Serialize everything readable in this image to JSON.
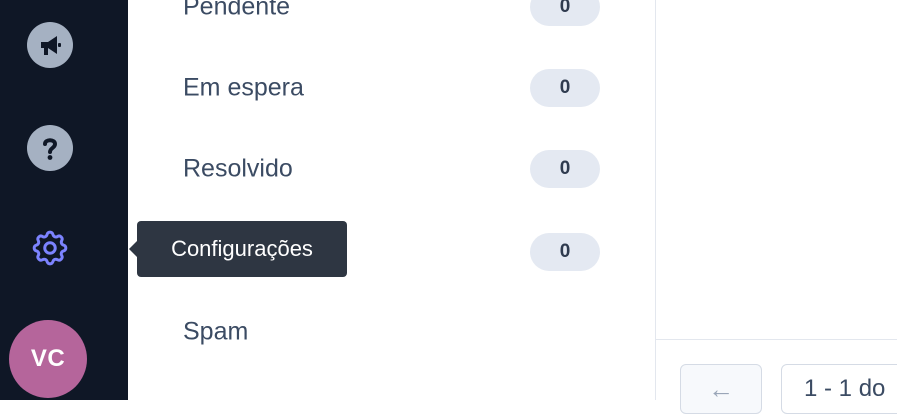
{
  "sidebar": {
    "icons": [
      {
        "name": "megaphone-icon"
      },
      {
        "name": "help-icon"
      },
      {
        "name": "gear-icon",
        "accent": "#7c83ff"
      }
    ],
    "avatar_initials": "VC"
  },
  "tooltip": {
    "text": "Configurações"
  },
  "folders": [
    {
      "label": "Pendente",
      "count": "0"
    },
    {
      "label": "Em espera",
      "count": "0"
    },
    {
      "label": "Resolvido",
      "count": "0"
    },
    {
      "label": "",
      "count": "0"
    },
    {
      "label": "Spam",
      "count": ""
    }
  ],
  "pagination": {
    "prev_icon": "←",
    "range_text": "1 - 1 do"
  },
  "colors": {
    "sidebar_bg": "#0f1726",
    "badge_bg": "#e4e9f2",
    "avatar_bg": "#b5659b",
    "tooltip_bg": "#2e3642"
  }
}
